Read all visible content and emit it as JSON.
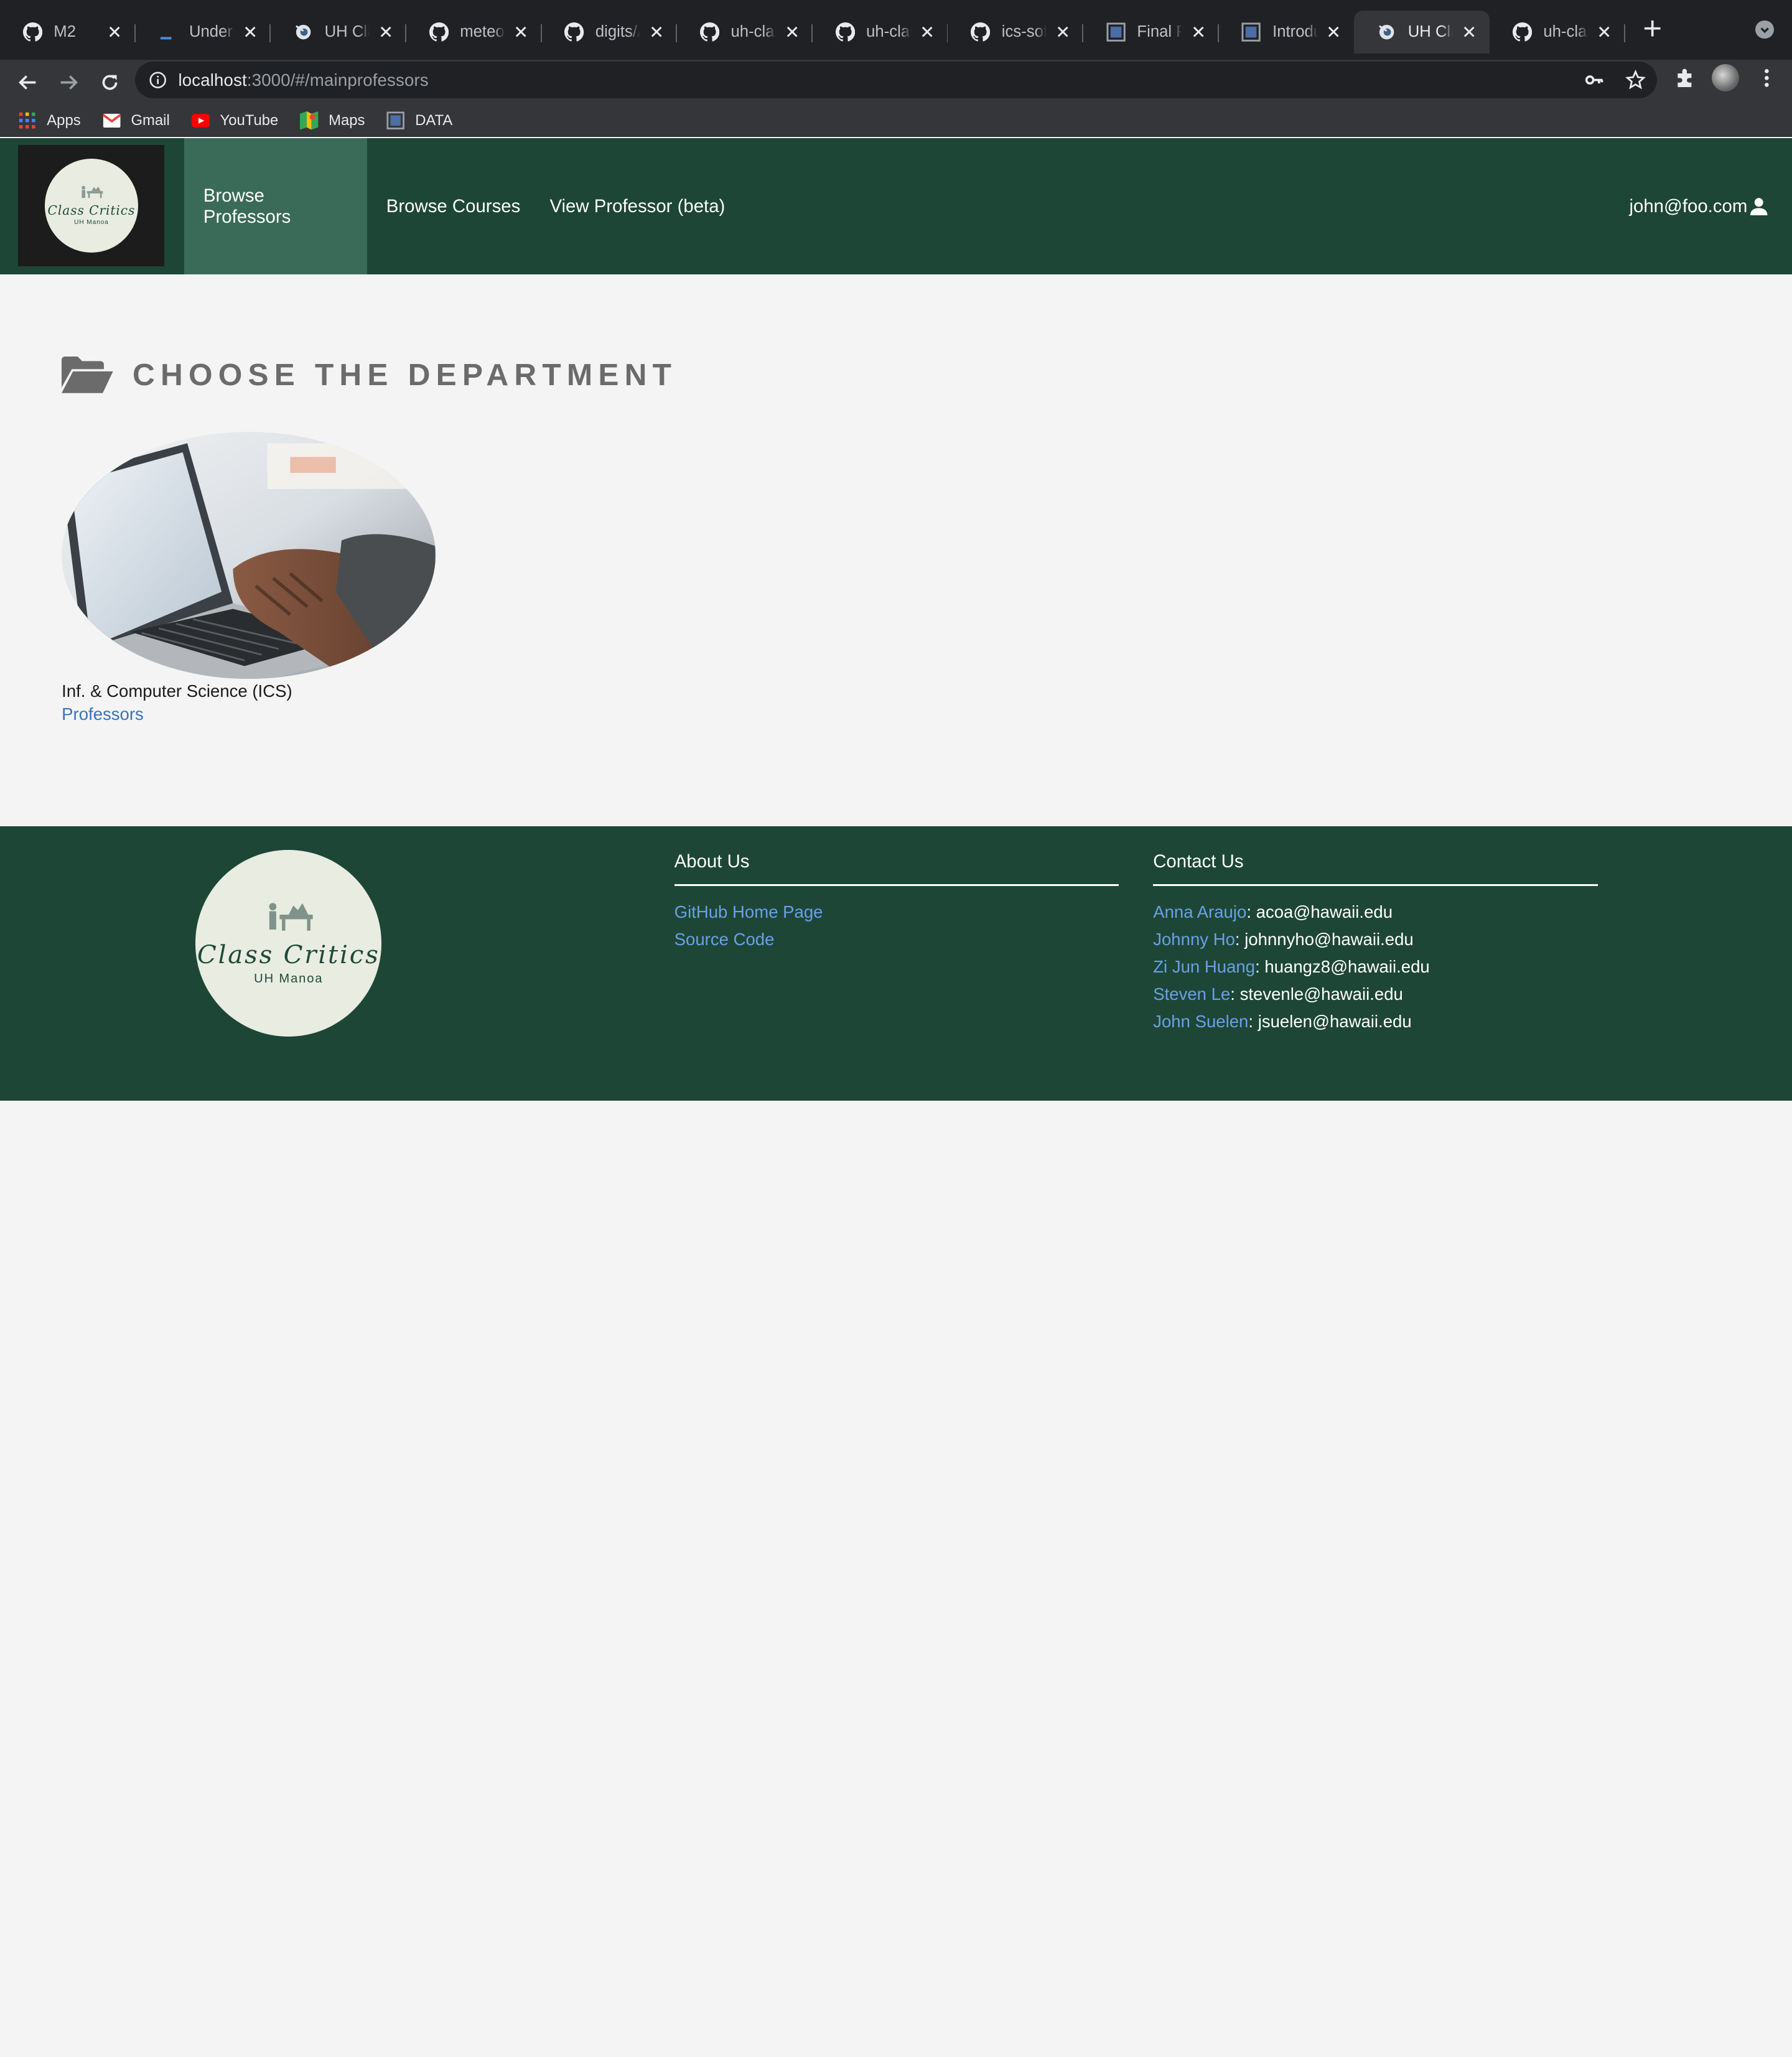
{
  "browser": {
    "tabs": [
      {
        "title": "M2",
        "icon": "github-icon"
      },
      {
        "title": "Underscore",
        "icon": "underscore-icon"
      },
      {
        "title": "UH Class Critics",
        "icon": "meteor-icon"
      },
      {
        "title": "meteor-",
        "icon": "github-icon"
      },
      {
        "title": "digits/A",
        "icon": "github-icon"
      },
      {
        "title": "uh-class",
        "icon": "github-icon"
      },
      {
        "title": "uh-class",
        "icon": "github-icon"
      },
      {
        "title": "ics-soft",
        "icon": "github-icon"
      },
      {
        "title": "Final Pro",
        "icon": "page-icon"
      },
      {
        "title": "Introduc",
        "icon": "page-icon"
      },
      {
        "title": "UH Class",
        "icon": "meteor-icon",
        "active": true
      },
      {
        "title": "uh-class",
        "icon": "github-icon"
      }
    ],
    "url": {
      "host": "localhost",
      "rest": ":3000/#/mainprofessors"
    },
    "bookmarks": [
      {
        "label": "Apps",
        "icon": "apps-grid-icon"
      },
      {
        "label": "Gmail",
        "icon": "gmail-icon"
      },
      {
        "label": "YouTube",
        "icon": "youtube-icon"
      },
      {
        "label": "Maps",
        "icon": "maps-icon"
      },
      {
        "label": "DATA",
        "icon": "page-icon"
      }
    ]
  },
  "navbar": {
    "logo": {
      "title": "Class Critics",
      "subtitle": "UH Manoa"
    },
    "items": [
      {
        "label": "Browse Professors",
        "active": true
      },
      {
        "label": "Browse Courses",
        "active": false
      },
      {
        "label": "View Professor (beta)",
        "active": false
      }
    ],
    "user": "john@foo.com"
  },
  "main": {
    "title": "CHOOSE THE DEPARTMENT",
    "departments": [
      {
        "name": "Inf. & Computer Science (ICS)",
        "link": "Professors"
      }
    ]
  },
  "footer": {
    "logo": {
      "title": "Class Critics",
      "subtitle": "UH Manoa"
    },
    "about": {
      "heading": "About Us",
      "links": [
        "GitHub Home Page",
        "Source Code"
      ]
    },
    "contact": {
      "heading": "Contact Us",
      "people": [
        {
          "name": "Anna Araujo",
          "email": ": acoa@hawaii.edu"
        },
        {
          "name": "Johnny Ho",
          "email": ": johnnyho@hawaii.edu"
        },
        {
          "name": "Zi Jun Huang",
          "email": ": huangz8@hawaii.edu"
        },
        {
          "name": "Steven Le",
          "email": ": stevenle@hawaii.edu"
        },
        {
          "name": "John Suelen",
          "email": ": jsuelen@hawaii.edu"
        }
      ]
    }
  },
  "colors": {
    "brand_green": "#1d4636",
    "nav_active": "#3a6b59",
    "link_blue": "#3b73b9",
    "footer_link": "#6aa0e8",
    "page_bg": "#f4f4f4"
  }
}
